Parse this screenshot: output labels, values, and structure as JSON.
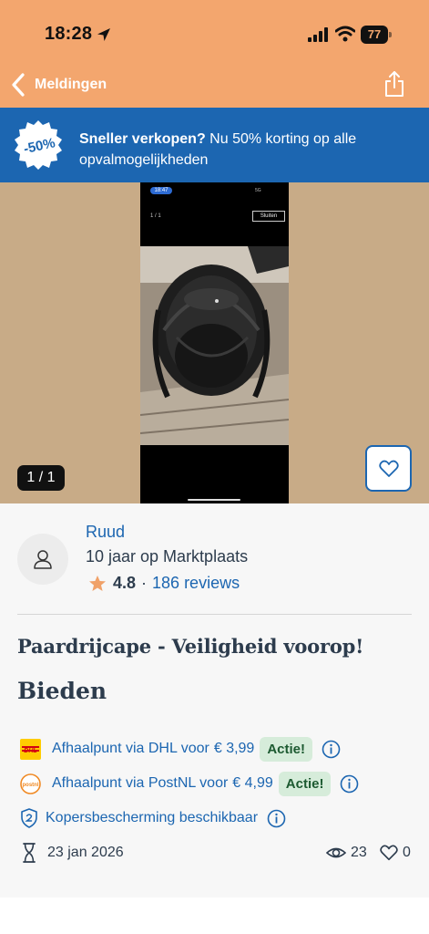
{
  "status_bar": {
    "time": "18:28",
    "battery": "77"
  },
  "nav": {
    "back_label": "Meldingen"
  },
  "promo": {
    "badge": "-50%",
    "strong": "Sneller verkopen?",
    "text": "Nu 50% korting op alle opvalmogelijkheden"
  },
  "gallery": {
    "counter": "1 / 1",
    "screenshot": {
      "time": "18:47",
      "status": "5G",
      "counter": "1 / 1",
      "close_label": "Sluiten"
    }
  },
  "seller": {
    "name": "Ruud",
    "since": "10 jaar op Marktplaats",
    "rating": "4.8",
    "separator": "·",
    "reviews": "186 reviews"
  },
  "listing": {
    "title": "Paardrijcape - Veiligheid voorop!",
    "price_label": "Bieden"
  },
  "shipping": [
    {
      "text": "Afhaalpunt via DHL voor",
      "price": "€ 3,99",
      "badge": "Actie!",
      "icon": "dhl-logo"
    },
    {
      "text": "Afhaalpunt via PostNL voor",
      "price": "€ 4,99",
      "badge": "Actie!",
      "icon": "postnl-logo"
    }
  ],
  "protection": {
    "text": "Kopersbescherming beschikbaar"
  },
  "meta": {
    "date": "23 jan 2026",
    "views": "23",
    "favorites": "0"
  },
  "colors": {
    "header": "#f3a66e",
    "promo": "#1c66b1",
    "link": "#1c66b1",
    "badge_bg": "#d6ecda"
  }
}
